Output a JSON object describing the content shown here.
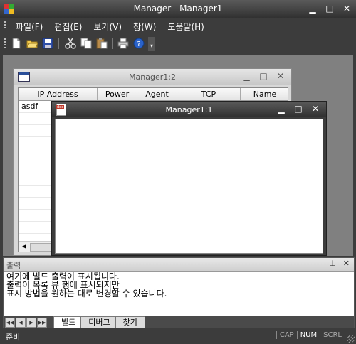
{
  "window": {
    "app_name": "Manager",
    "separator": " - ",
    "doc_name": "Manager1"
  },
  "menu": [
    "파일(F)",
    "편집(E)",
    "보기(V)",
    "창(W)",
    "도움말(H)"
  ],
  "toolbar_icons": [
    "new-icon",
    "open-icon",
    "save-icon",
    "cut-icon",
    "copy-icon",
    "paste-icon",
    "print-icon",
    "help-icon"
  ],
  "child_windows": {
    "w12": {
      "title": "Manager1:2"
    },
    "w11": {
      "title": "Manager1:1"
    }
  },
  "grid": {
    "columns": [
      "IP Address",
      "Power",
      "Agent",
      "TCP",
      "Name"
    ],
    "rows": [
      "asdf"
    ]
  },
  "output": {
    "title": "출력",
    "lines": [
      "여기에 빌드 출력이 표시됩니다.",
      "출력이 목록 뷰 행에 표시되지만",
      "표시 방법을 원하는 대로 변경할 수 있습니다."
    ],
    "tabs": [
      "빌드",
      "디버그",
      "찾기"
    ],
    "active_tab": 0
  },
  "status": {
    "text": "준비",
    "indicators": [
      {
        "label": "CAP",
        "active": false
      },
      {
        "label": "NUM",
        "active": true
      },
      {
        "label": "SCRL",
        "active": false
      }
    ]
  }
}
